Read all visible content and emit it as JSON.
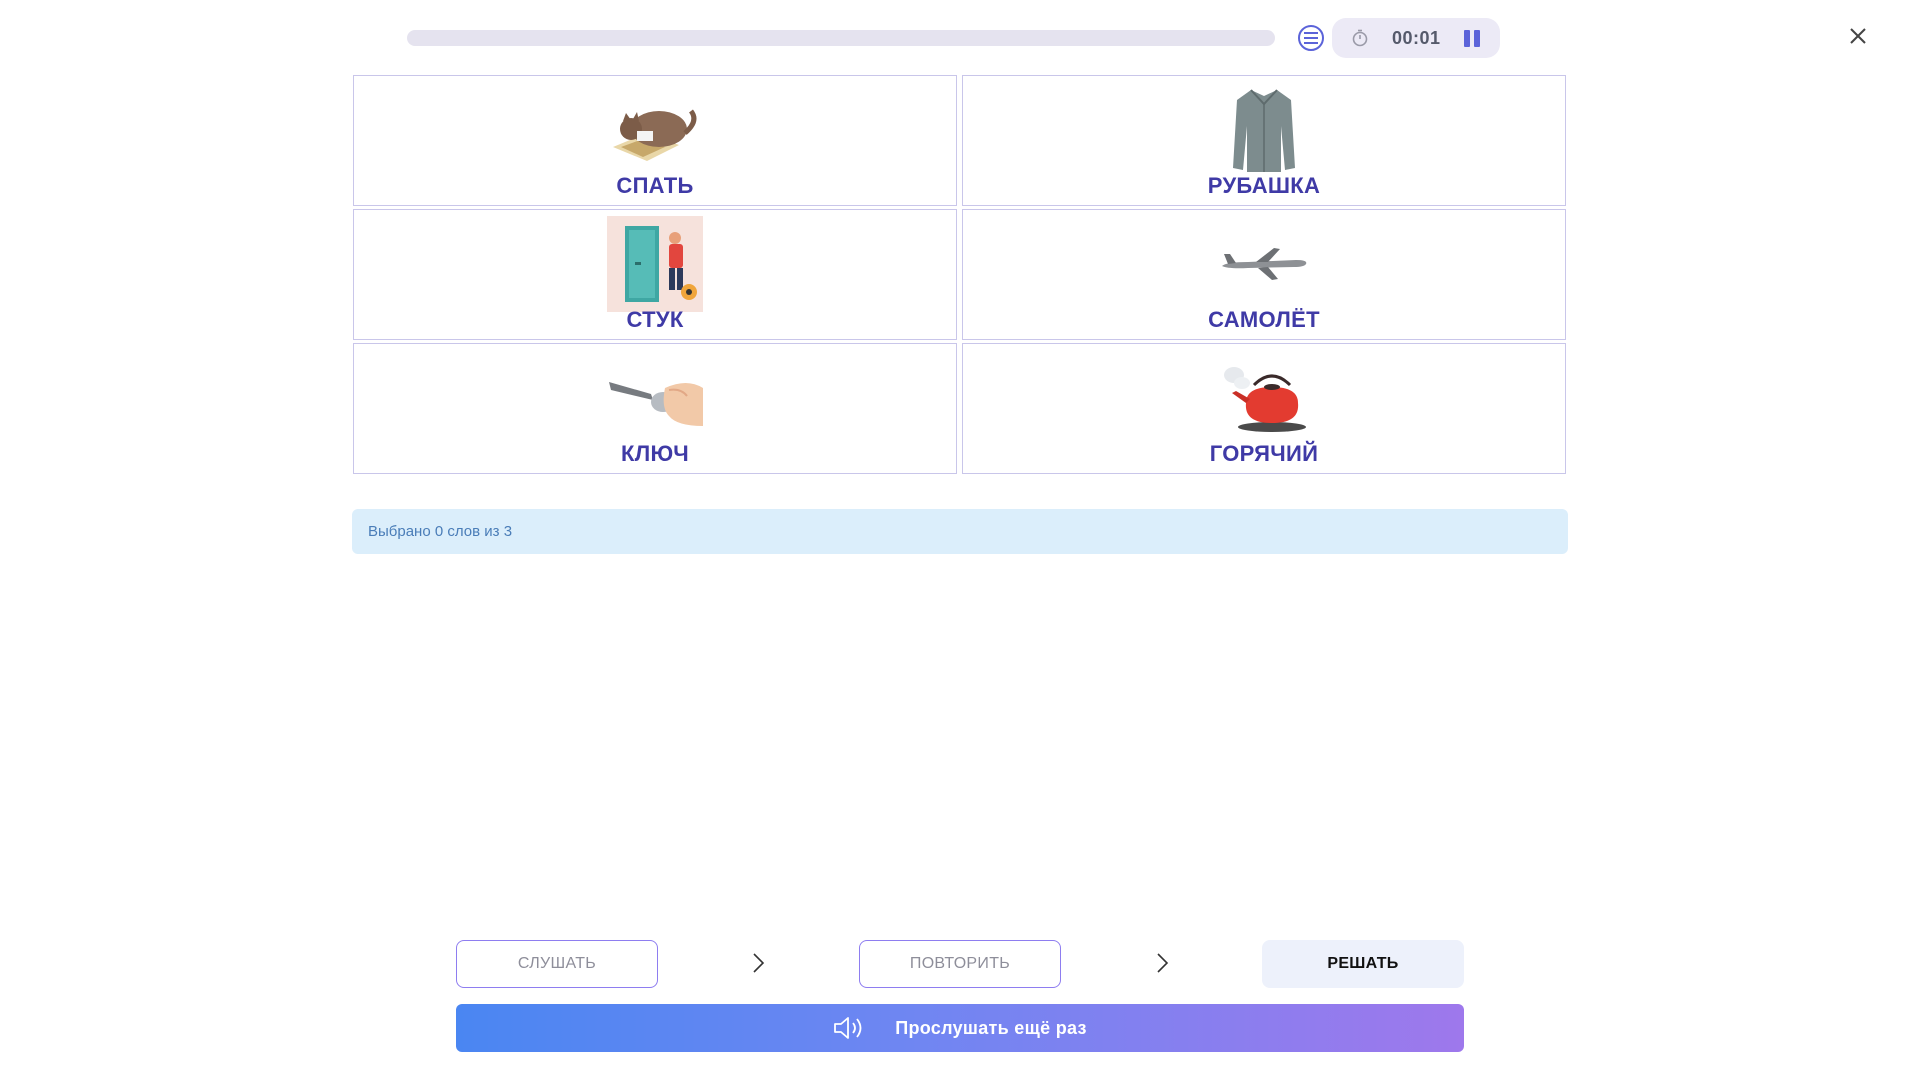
{
  "progress": {
    "value": 0
  },
  "timer": {
    "time": "00:01"
  },
  "cards": [
    {
      "word": "СПАТЬ",
      "icon": "sleeping-cat-image"
    },
    {
      "word": "РУБАШКА",
      "icon": "shirt-image"
    },
    {
      "word": "СТУК",
      "icon": "door-knock-image"
    },
    {
      "word": "САМОЛЁТ",
      "icon": "airplane-image"
    },
    {
      "word": "КЛЮЧ",
      "icon": "key-image"
    },
    {
      "word": "ГОРЯЧИЙ",
      "icon": "hot-kettle-image"
    }
  ],
  "info": {
    "text": "Выбрано 0 слов из 3"
  },
  "steps": {
    "listen": "СЛУШАТЬ",
    "repeat": "ПОВТОРИТЬ",
    "solve": "РЕШАТЬ"
  },
  "listen_again": {
    "label": "Прослушать ещё раз"
  },
  "colors": {
    "accent": "#3f3aa6",
    "info_bg": "#dbeefb",
    "gradient_start": "#4a86f2",
    "gradient_end": "#9e78ec"
  }
}
